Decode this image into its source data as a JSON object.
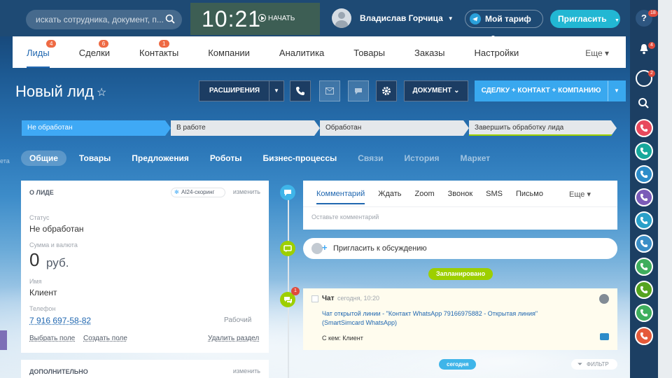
{
  "topbar": {
    "search_placeholder": "искать сотрудника, документ, п...",
    "clock_time": "10:21",
    "start_label": "НАЧАТЬ",
    "user_name": "Владислав Горчица",
    "tariff_label": "Мой тариф",
    "invite_label": "Пригласить"
  },
  "rail": {
    "help_badge": "18",
    "notif_badge": "4",
    "chat_badge": "2",
    "phone_colors": [
      "#e8495d",
      "#17a89c",
      "#2d8cc9",
      "#7b5bb8",
      "#2aa0c9",
      "#3b8ec7",
      "#3fae5d",
      "#55a41f",
      "#3fae5d",
      "#e55a3a"
    ]
  },
  "nav": {
    "items": [
      {
        "label": "Лиды",
        "badge": "4"
      },
      {
        "label": "Сделки",
        "badge": "6"
      },
      {
        "label": "Контакты",
        "badge": "1"
      },
      {
        "label": "Компании",
        "badge": ""
      },
      {
        "label": "Аналитика",
        "badge": ""
      },
      {
        "label": "Товары",
        "badge": ""
      },
      {
        "label": "Заказы",
        "badge": ""
      },
      {
        "label": "Настройки",
        "badge": ""
      }
    ],
    "more": "Еще"
  },
  "page": {
    "title": "Новый лид",
    "extensions_label": "РАСШИРЕНИЯ",
    "document_label": "ДОКУМЕНТ",
    "convert_label": "СДЕЛКУ + КОНТАКТ + КОМПАНИЮ"
  },
  "stages": [
    "Не обработан",
    "В работе",
    "Обработан",
    "Завершить обработку лида"
  ],
  "tabs": [
    "Общие",
    "Товары",
    "Предложения",
    "Роботы",
    "Бизнес-процессы",
    "Связи",
    "История",
    "Маркет"
  ],
  "about": {
    "header": "О ЛИДЕ",
    "ai_label": "AI24-скоринг",
    "edit_label": "изменить",
    "status_label": "Статус",
    "status_value": "Не обработан",
    "sum_label": "Сумма и валюта",
    "sum_value": "0",
    "sum_currency": "руб.",
    "name_label": "Имя",
    "name_value": "Клиент",
    "phone_label": "Телефон",
    "phone_value": "7 916 697-58-82",
    "phone_type": "Рабочий",
    "choose_field": "Выбрать поле",
    "create_field": "Создать поле",
    "delete_section": "Удалить раздел"
  },
  "more_card": {
    "header": "ДОПОЛНИТЕЛЬНО",
    "edit_label": "изменить"
  },
  "composer": {
    "tabs": [
      "Комментарий",
      "Ждать",
      "Zoom",
      "Звонок",
      "SMS",
      "Письмо"
    ],
    "more": "Еще",
    "placeholder": "Оставьте комментарий"
  },
  "timeline": {
    "invite_label": "Пригласить к обсуждению",
    "planned_label": "Запланировано",
    "chat_badge": "1",
    "chat_title": "Чат",
    "chat_time": "сегодня, 10:20",
    "chat_message": "Чат открытой линии - \"Контакт WhatsApp 79166975882 - Открытая линия\" (SmartSimcard WhatsApp)",
    "chat_with": "С кем: Клиент",
    "today_label": "сегодня",
    "filter_label": "ФИЛЬТР"
  }
}
